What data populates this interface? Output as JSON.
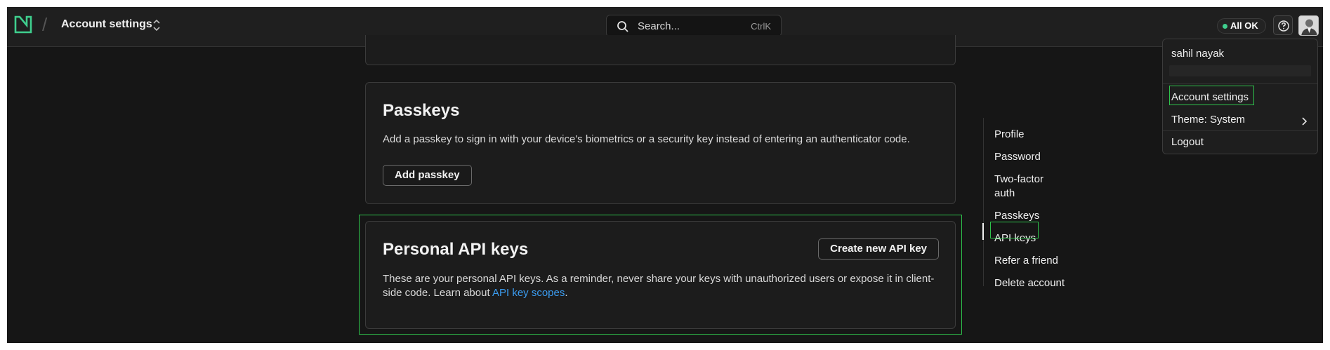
{
  "header": {
    "workspace_title": "Account settings",
    "search_placeholder": "Search...",
    "search_shortcut": "CtrlK",
    "status_label": "All OK",
    "help_icon": "help-circle-icon",
    "logo_icon": "posthog-logo-icon",
    "switch_icon": "chevron-up-down-icon",
    "search_icon": "search-icon"
  },
  "sections": {
    "passkeys": {
      "title": "Passkeys",
      "description": "Add a passkey to sign in with your device's biometrics or a security key instead of entering an authenticator code.",
      "button": "Add passkey"
    },
    "api_keys": {
      "title": "Personal API keys",
      "button": "Create new API key",
      "description_line1": "These are your personal API keys. As a reminder, never share your keys with unauthorized users or expose it in client-",
      "description_line2_prefix": "side code. Learn about ",
      "description_link": "API key scopes",
      "description_suffix": "."
    }
  },
  "sidenav": {
    "items": [
      {
        "label": "Profile"
      },
      {
        "label": "Password"
      },
      {
        "label": "Two-factor"
      },
      {
        "label": "auth"
      },
      {
        "label": "Passkeys"
      },
      {
        "label": "API keys",
        "active": true
      },
      {
        "label": "Refer a friend"
      },
      {
        "label": "Delete account"
      }
    ]
  },
  "user_menu": {
    "name": "sahil nayak",
    "items": [
      {
        "label": "Account settings"
      },
      {
        "label": "Theme: System"
      },
      {
        "label": "Logout"
      }
    ]
  },
  "colors": {
    "accent_green": "#3fcf8e",
    "highlight": "#2ec24b",
    "link": "#3b9cf0",
    "background": "#161616"
  }
}
